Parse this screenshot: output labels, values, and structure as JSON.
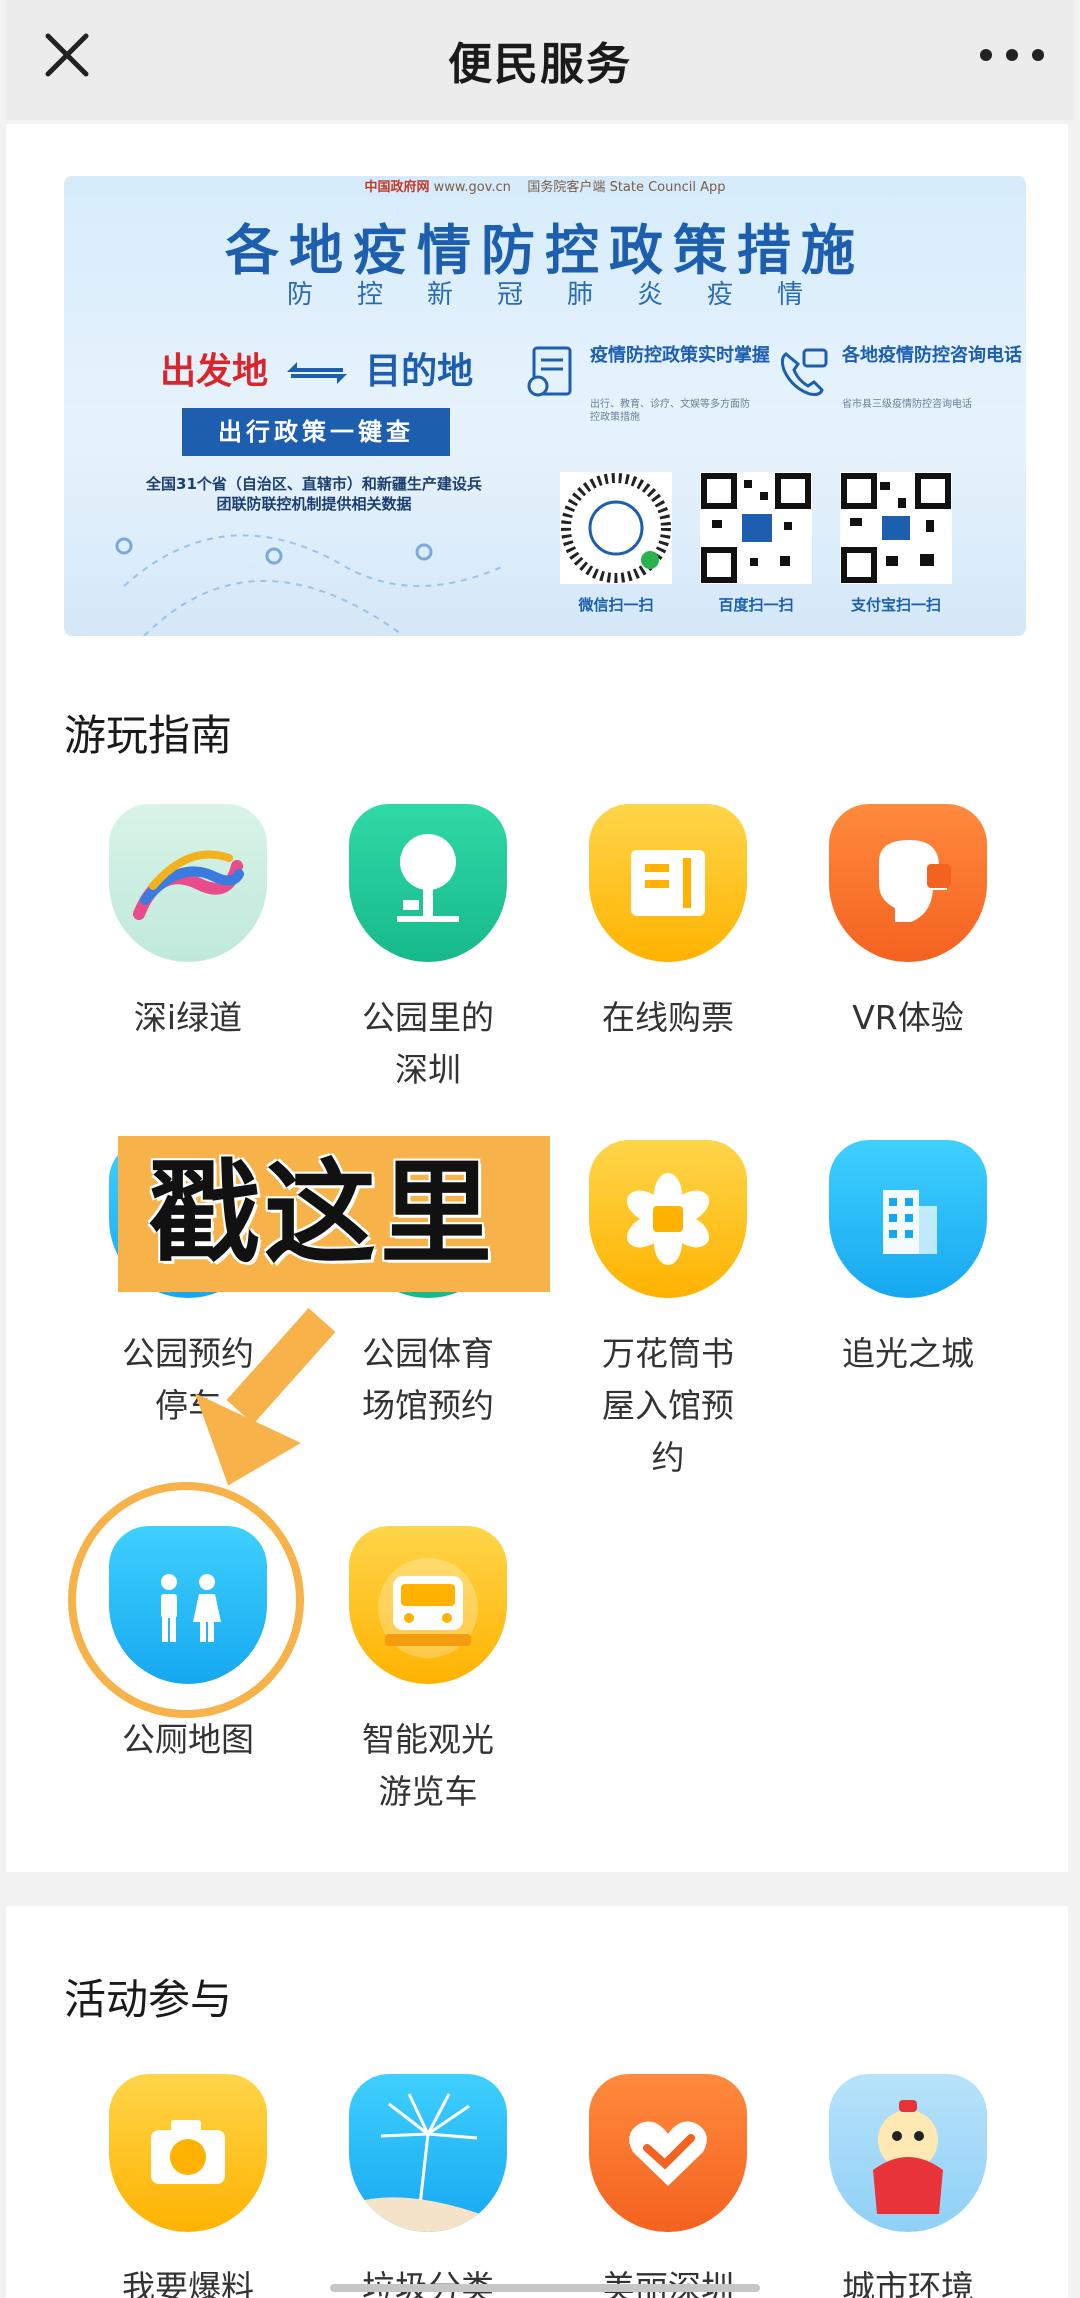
{
  "topbar": {
    "title": "便民服务"
  },
  "banner": {
    "gov_left": "中国政府网",
    "gov_left_url": "www.gov.cn",
    "gov_right": "国务院客户端",
    "gov_right_en": "State Council App",
    "title": "各地疫情防控政策措施",
    "subtitle": "防控新冠肺炎疫情",
    "from": "出发地",
    "to": "目的地",
    "one_click": "出行政策一键查",
    "note": "全国31个省（自治区、直辖市）和新疆生产建设兵团联防联控机制提供相关数据",
    "info1_title": "疫情防控政策实时掌握",
    "info1_desc": "出行、教育、诊疗、文娱等多方面防控政策措施",
    "info2_title": "各地疫情防控咨询电话",
    "info2_desc": "省市县三级疫情防控咨询电话",
    "qr_labels": [
      "微信扫一扫",
      "百度扫一扫",
      "支付宝扫一扫"
    ]
  },
  "guide": {
    "title": "游玩指南",
    "apps": [
      {
        "label": "深i绿道",
        "icon": "greenway-icon"
      },
      {
        "label": "公园里的深圳",
        "icon": "park-tree-icon"
      },
      {
        "label": "在线购票",
        "icon": "ticket-icon"
      },
      {
        "label": "VR体验",
        "icon": "vr-headset-icon"
      },
      {
        "label": "公园预约停车",
        "icon": "parking-icon"
      },
      {
        "label": "公园体育场馆预约",
        "icon": "stadium-icon"
      },
      {
        "label": "万花筒书屋入馆预约",
        "icon": "kaleidoscope-book-icon"
      },
      {
        "label": "追光之城",
        "icon": "city-building-icon"
      },
      {
        "label": "公厕地图",
        "icon": "toilet-icon"
      },
      {
        "label": "智能观光游览车",
        "icon": "tour-bus-icon"
      }
    ]
  },
  "overlay": {
    "text": "戳这里"
  },
  "activity": {
    "title": "活动参与",
    "apps": [
      {
        "label": "我要爆料",
        "icon": "camera-icon"
      },
      {
        "label": "垃圾分类",
        "icon": "dandelion-icon"
      },
      {
        "label": "美丽深圳",
        "icon": "heart-hand-icon"
      },
      {
        "label": "城市环境",
        "icon": "mascot-icon"
      }
    ]
  },
  "colors": {
    "accent_orange": "#f7b24a",
    "gov_blue": "#1d5fae",
    "red": "#d9252c"
  }
}
